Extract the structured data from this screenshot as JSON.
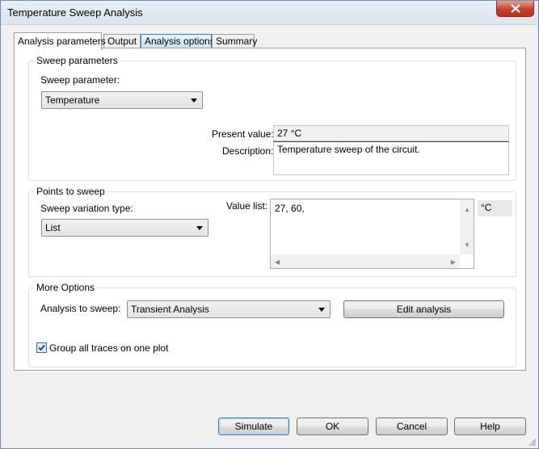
{
  "window": {
    "title": "Temperature Sweep Analysis"
  },
  "tabs": [
    "Analysis parameters",
    "Output",
    "Analysis options",
    "Summary"
  ],
  "sweep_parameters": {
    "group_title": "Sweep parameters",
    "param_label": "Sweep parameter:",
    "param_value": "Temperature",
    "present_value_label": "Present value:",
    "present_value": "27 °C",
    "description_label": "Description:",
    "description": "Temperature sweep of the circuit."
  },
  "points_to_sweep": {
    "group_title": "Points to sweep",
    "variation_label": "Sweep variation type:",
    "variation_value": "List",
    "value_list_label": "Value list:",
    "value_list": "27, 60,",
    "unit": "°C"
  },
  "more_options": {
    "group_title": "More Options",
    "analysis_label": "Analysis to sweep:",
    "analysis_value": "Transient Analysis",
    "edit_button": "Edit analysis",
    "group_traces_label": "Group all traces on one plot",
    "group_traces_checked": true
  },
  "footer": {
    "simulate": "Simulate",
    "ok": "OK",
    "cancel": "Cancel",
    "help": "Help"
  }
}
